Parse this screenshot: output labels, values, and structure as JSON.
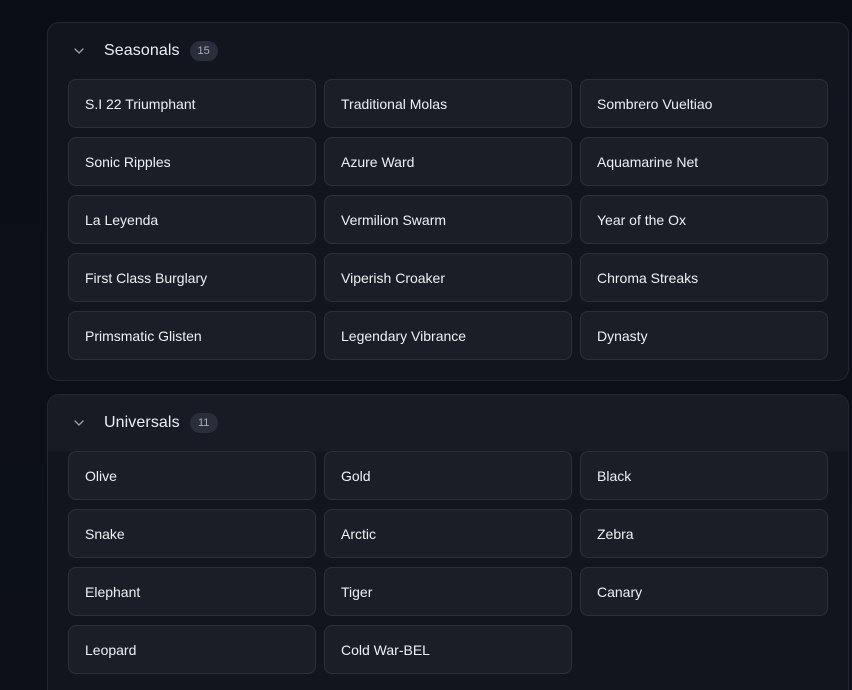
{
  "seasonals": {
    "title": "Seasonals",
    "count": "15",
    "items": [
      "S.I 22 Triumphant",
      "Traditional Molas",
      "Sombrero Vueltiao",
      "Sonic Ripples",
      "Azure Ward",
      "Aquamarine Net",
      "La Leyenda",
      "Vermilion Swarm",
      "Year of the Ox",
      "First Class Burglary",
      "Viperish Croaker",
      "Chroma Streaks",
      "Primsmatic Glisten",
      "Legendary Vibrance",
      "Dynasty"
    ]
  },
  "universals": {
    "title": "Universals",
    "count": "11",
    "items": [
      "Olive",
      "Gold",
      "Black",
      "Snake",
      "Arctic",
      "Zebra",
      "Elephant",
      "Tiger",
      "Canary",
      "Leopard",
      "Cold War-BEL"
    ]
  },
  "icons": {
    "collapse": "chevron-down-icon"
  },
  "colors": {
    "background": "#0c0f17",
    "panel": "#12151d",
    "item": "#1b1e27",
    "badge": "#2a2e3a"
  }
}
